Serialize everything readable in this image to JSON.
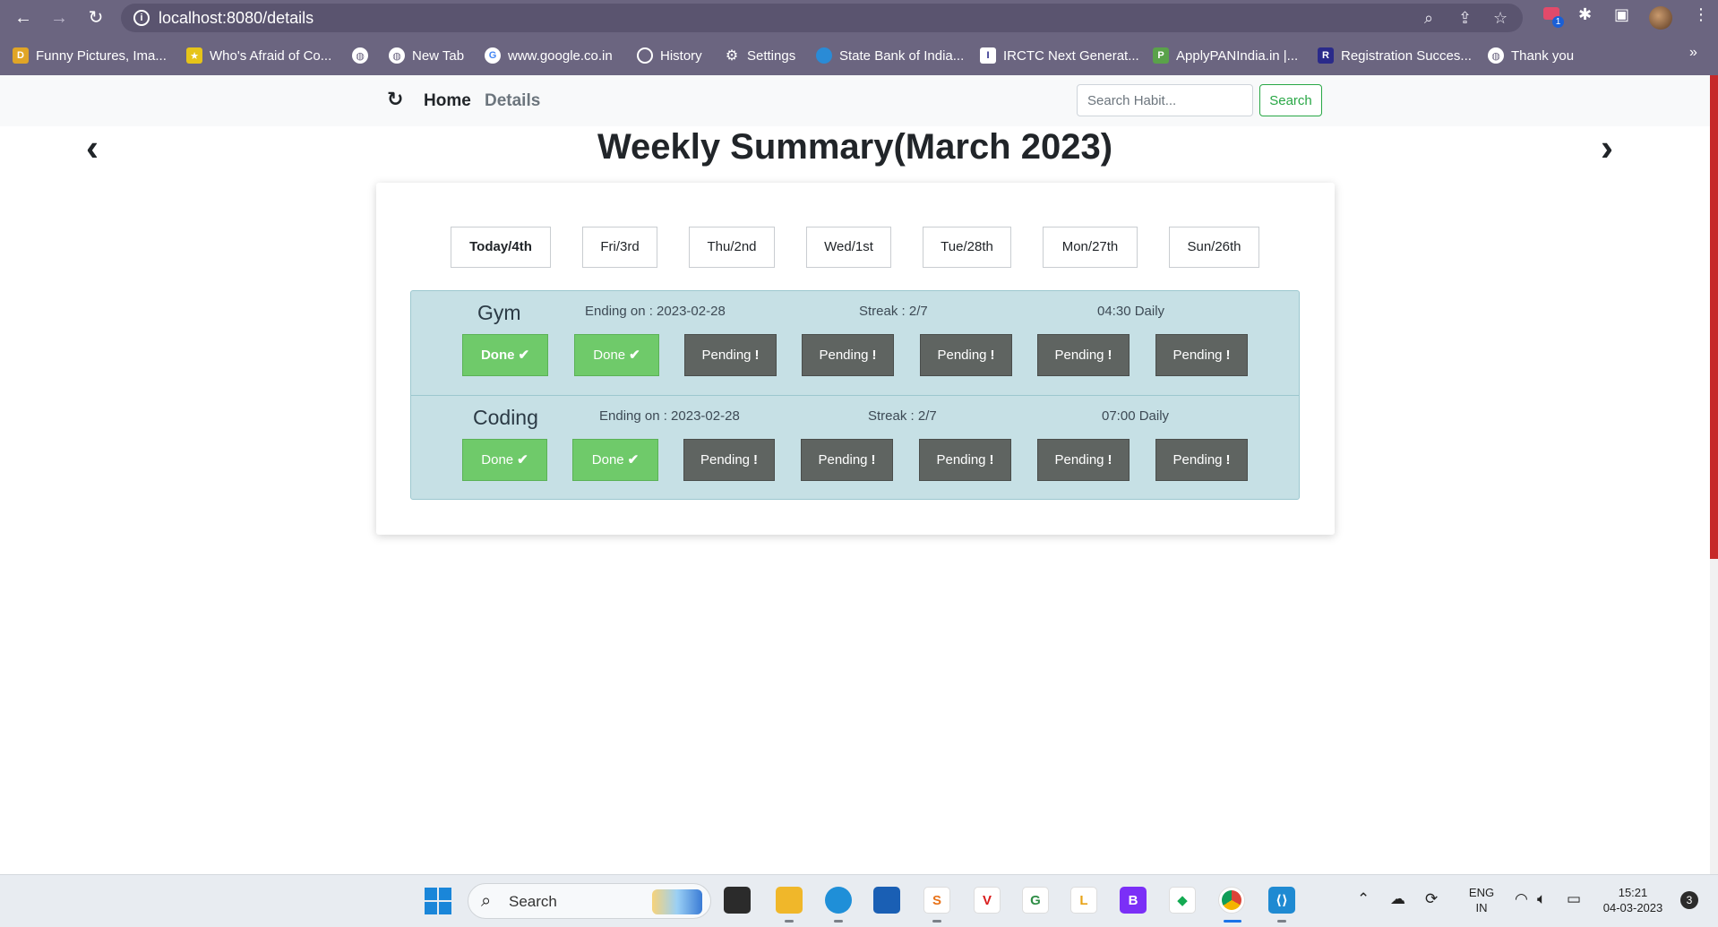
{
  "browser": {
    "url": "localhost:8080/details",
    "extension_badge": "1",
    "bookmarks": [
      {
        "label": "Funny Pictures, Ima...",
        "icon": "dc-icon",
        "color": "#e0a526"
      },
      {
        "label": "Who's Afraid of Co...",
        "icon": "bookmark-yellow-icon",
        "color": "#e6c419"
      },
      {
        "label": "",
        "icon": "globe-icon",
        "color": "#ffffff"
      },
      {
        "label": "New Tab",
        "icon": "globe-icon",
        "color": "#ffffff"
      },
      {
        "label": "www.google.co.in",
        "icon": "google-icon",
        "color": "#ffffff"
      },
      {
        "label": "History",
        "icon": "history-icon",
        "color": "#ffffff"
      },
      {
        "label": "Settings",
        "icon": "gear-icon",
        "color": "#ffffff"
      },
      {
        "label": "State Bank of India...",
        "icon": "sbi-icon",
        "color": "#2a8bd6"
      },
      {
        "label": "IRCTC Next Generat...",
        "icon": "irctc-icon",
        "color": "#ffffff"
      },
      {
        "label": "ApplyPANIndia.in |...",
        "icon": "pan-icon",
        "color": "#5aa24a"
      },
      {
        "label": "Registration Succes...",
        "icon": "registration-icon",
        "color": "#2a2a8a"
      },
      {
        "label": "Thank you",
        "icon": "globe-icon",
        "color": "#ffffff"
      }
    ],
    "more_label": "»"
  },
  "app_nav": {
    "refresh_icon": "↻",
    "home": "Home",
    "details": "Details",
    "search_placeholder": "Search Habit...",
    "search_button": "Search"
  },
  "page": {
    "title": "Weekly Summary(March 2023)",
    "prev_icon": "‹",
    "next_icon": "›"
  },
  "days": [
    "Today/4th",
    "Fri/3rd",
    "Thu/2nd",
    "Wed/1st",
    "Tue/28th",
    "Mon/27th",
    "Sun/26th"
  ],
  "habits": [
    {
      "name": "Gym",
      "ending": "Ending on : 2023-02-28",
      "streak": "Streak : 2/7",
      "schedule": "04:30 Daily",
      "statuses": [
        {
          "label": "Done",
          "mark": "✔",
          "state": "done"
        },
        {
          "label": "Done",
          "mark": "✔",
          "state": "done"
        },
        {
          "label": "Pending",
          "mark": "!",
          "state": "pending"
        },
        {
          "label": "Pending",
          "mark": "!",
          "state": "pending"
        },
        {
          "label": "Pending",
          "mark": "!",
          "state": "pending"
        },
        {
          "label": "Pending",
          "mark": "!",
          "state": "pending"
        },
        {
          "label": "Pending",
          "mark": "!",
          "state": "pending"
        }
      ]
    },
    {
      "name": "Coding",
      "ending": "Ending on : 2023-02-28",
      "streak": "Streak : 2/7",
      "schedule": "07:00 Daily",
      "statuses": [
        {
          "label": "Done",
          "mark": "✔",
          "state": "done"
        },
        {
          "label": "Done",
          "mark": "✔",
          "state": "done"
        },
        {
          "label": "Pending",
          "mark": "!",
          "state": "pending"
        },
        {
          "label": "Pending",
          "mark": "!",
          "state": "pending"
        },
        {
          "label": "Pending",
          "mark": "!",
          "state": "pending"
        },
        {
          "label": "Pending",
          "mark": "!",
          "state": "pending"
        },
        {
          "label": "Pending",
          "mark": "!",
          "state": "pending"
        }
      ]
    }
  ],
  "taskbar": {
    "search_label": "Search",
    "lang_top": "ENG",
    "lang_bottom": "IN",
    "time": "15:21",
    "date": "04-03-2023",
    "notifications": "3"
  },
  "colors": {
    "done": "#6fca6a",
    "pending": "#5f6461",
    "table_bg": "#c6e0e5",
    "browser_chrome": "#6b6580",
    "search_green": "#28a745"
  }
}
